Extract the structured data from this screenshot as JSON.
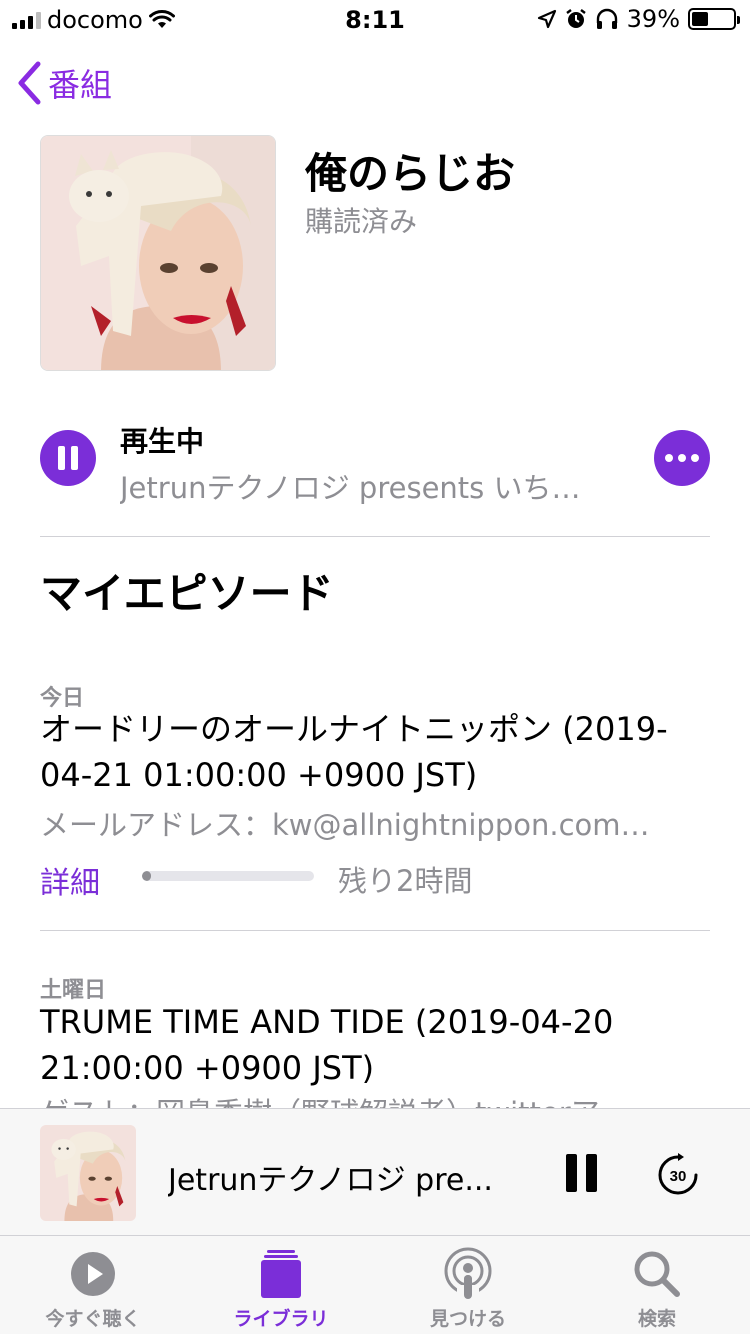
{
  "status_bar": {
    "carrier": "docomo",
    "time": "8:11",
    "battery": "39%",
    "battery_level": 0.39,
    "icons": [
      "signal-icon",
      "wifi-icon",
      "location-icon",
      "alarm-icon",
      "headphones-icon",
      "battery-icon"
    ]
  },
  "nav": {
    "back_label": "番組"
  },
  "show": {
    "title": "俺のらじお",
    "subtitle": "購読済み"
  },
  "now_playing": {
    "label": "再生中",
    "episode": "Jetrunテクノロジ presents いち…"
  },
  "section_title": "マイエピソード",
  "episodes": [
    {
      "date": "今日",
      "title": "オードリーのオールナイトニッポン (2019-04-21 01:00:00 +0900 JST)",
      "description": "メールアドレス：kw@allnightnippon.com…",
      "detail_label": "詳細",
      "progress": 0.05,
      "remaining": "残り2時間"
    },
    {
      "date": "土曜日",
      "title": "TRUME TIME AND TIDE (2019-04-20 21:00:00 +0900 JST)",
      "description": "ゲスト：岡島秀樹（野球解説者）twitterア…"
    }
  ],
  "mini_player": {
    "title": "Jetrunテクノロジ pre...",
    "skip_label": "30"
  },
  "tabs": [
    {
      "label": "今すぐ聴く",
      "icon": "play-circle-icon",
      "active": false
    },
    {
      "label": "ライブラリ",
      "icon": "library-icon",
      "active": true
    },
    {
      "label": "見つける",
      "icon": "podcast-icon",
      "active": false
    },
    {
      "label": "検索",
      "icon": "search-icon",
      "active": false
    }
  ],
  "colors": {
    "accent": "#7b2ed8",
    "secondary_text": "#8e8e93"
  }
}
